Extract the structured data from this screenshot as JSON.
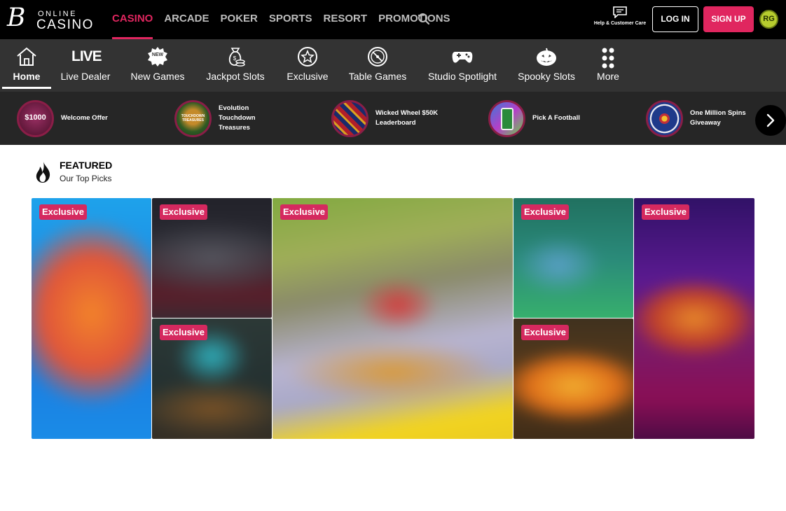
{
  "brand": {
    "logo_letter": "B",
    "logo_top": "ONLINE",
    "logo_bottom": "CASINO"
  },
  "main_nav": [
    {
      "label": "CASINO",
      "active": true
    },
    {
      "label": "ARCADE"
    },
    {
      "label": "POKER"
    },
    {
      "label": "SPORTS"
    },
    {
      "label": "RESORT"
    },
    {
      "label": "PROMOTIONS"
    }
  ],
  "header": {
    "help_label": "Help & Customer Care",
    "login_label": "LOG IN",
    "signup_label": "SIGN UP",
    "rg_label": "RG",
    "accent_color": "#e0265f"
  },
  "category_nav": [
    {
      "label": "Home",
      "icon": "home-icon",
      "active": true
    },
    {
      "label": "Live Dealer",
      "icon": "live-icon",
      "icon_text": "LIVE"
    },
    {
      "label": "New Games",
      "icon": "new-badge-icon",
      "icon_text": "NEW"
    },
    {
      "label": "Jackpot Slots",
      "icon": "money-bag-icon"
    },
    {
      "label": "Exclusive",
      "icon": "star-icon"
    },
    {
      "label": "Table Games",
      "icon": "roulette-icon"
    },
    {
      "label": "Studio Spotlight",
      "icon": "gamepad-icon"
    },
    {
      "label": "Spooky Slots",
      "icon": "pumpkin-icon"
    },
    {
      "label": "More",
      "icon": "dots-grid-icon"
    }
  ],
  "promos": [
    {
      "label": "Welcome Offer",
      "thumb_text": "$1000"
    },
    {
      "label": "Evolution Touchdown Treasures",
      "thumb_text": "TOUCHDOWN TREASURES"
    },
    {
      "label": "Wicked Wheel $50K Leaderboard"
    },
    {
      "label": "Pick A Football"
    },
    {
      "label": "One Million Spins Giveaway"
    }
  ],
  "featured": {
    "title": "FEATURED",
    "subtitle": "Our Top Picks",
    "badge_label": "Exclusive",
    "tiles": [
      {
        "badge": "Exclusive",
        "colors": [
          "#1d8be0",
          "#f27b2a",
          "#1aa0e8"
        ]
      },
      {
        "badge": "Exclusive",
        "colors": [
          "#2a2a35",
          "#5a1e2a",
          "#3a3a3a"
        ]
      },
      {
        "badge": "Exclusive",
        "colors": [
          "#2f3b39",
          "#0f6b6e",
          "#6b4d2a"
        ]
      },
      {
        "badge": "Exclusive",
        "colors": [
          "#7fa23a",
          "#b8b4d0",
          "#f2d020"
        ]
      },
      {
        "badge": "Exclusive",
        "colors": [
          "#1f6b52",
          "#2f9a8a",
          "#39b56a"
        ]
      },
      {
        "badge": "Exclusive",
        "colors": [
          "#3a2a1e",
          "#e07a1a",
          "#f2c030"
        ]
      },
      {
        "badge": "Exclusive",
        "colors": [
          "#3a1070",
          "#e07a1a",
          "#8a0f5a"
        ]
      }
    ]
  }
}
